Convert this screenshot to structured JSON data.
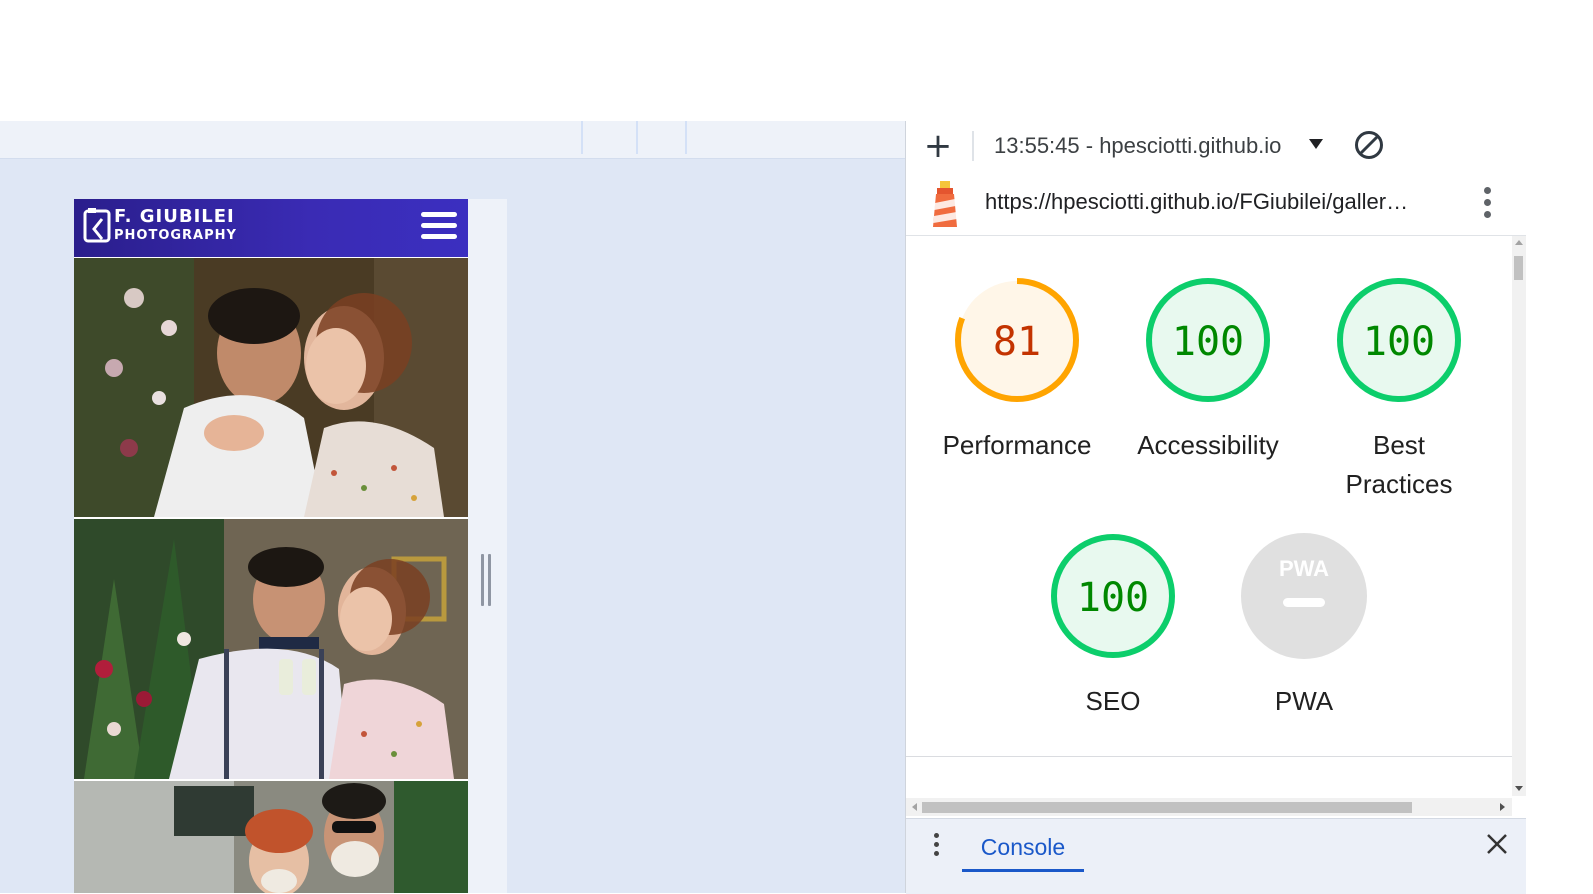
{
  "devtools": {
    "add_label": "+",
    "report_selector": "13:55:45 - hpesciotti.github.io",
    "url": "https://hpesciotti.github.io/FGiubilei/galler…",
    "drawer_tab": "Console"
  },
  "site": {
    "logo_line1": "F. GIUBILEI",
    "logo_line2": "PHOTOGRAPHY"
  },
  "lighthouse": {
    "scores": [
      {
        "label": "Performance",
        "score": 81,
        "status": "average"
      },
      {
        "label": "Accessibility",
        "score": 100,
        "status": "pass"
      },
      {
        "label": "Best Practices",
        "score": 100,
        "status": "pass"
      },
      {
        "label": "SEO",
        "score": 100,
        "status": "pass"
      },
      {
        "label": "PWA",
        "score": null,
        "status": "na",
        "badge": "PWA"
      }
    ],
    "colors": {
      "average_ring": "#ffa400",
      "average_fill": "#fff6e8",
      "average_text": "#c33300",
      "pass_ring": "#0cce6b",
      "pass_fill": "#e8f9ef",
      "pass_text": "#008800",
      "na_fill": "#e0e0e0"
    }
  },
  "theme": {
    "header_bg": "#3125a9",
    "devtools_accent": "#1a58c9"
  }
}
